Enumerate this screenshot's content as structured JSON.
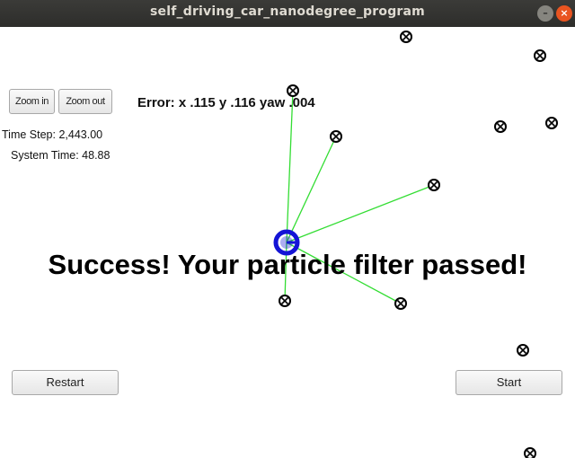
{
  "window": {
    "title": "self_driving_car_nanodegree_program",
    "minimize_glyph": "–",
    "close_glyph": "×"
  },
  "controls": {
    "zoom_in_label": "Zoom in",
    "zoom_out_label": "Zoom out",
    "restart_label": "Restart",
    "start_label": "Start"
  },
  "status": {
    "time_step_label": "Time Step: 2,443.00",
    "system_time_label": "System Time: 48.88",
    "error_label": "Error: x .115 y .116 yaw .004"
  },
  "message": {
    "success_text": "Success! Your particle filter passed!"
  },
  "colors": {
    "vehicle": "#1414d6",
    "observation_line": "#33dd33",
    "landmark": "#000000",
    "close_button": "#e95420"
  },
  "icons": {
    "landmark": "landmark-marker-icon",
    "vehicle": "vehicle-icon",
    "minimize": "minimize-icon",
    "close": "close-icon"
  }
}
